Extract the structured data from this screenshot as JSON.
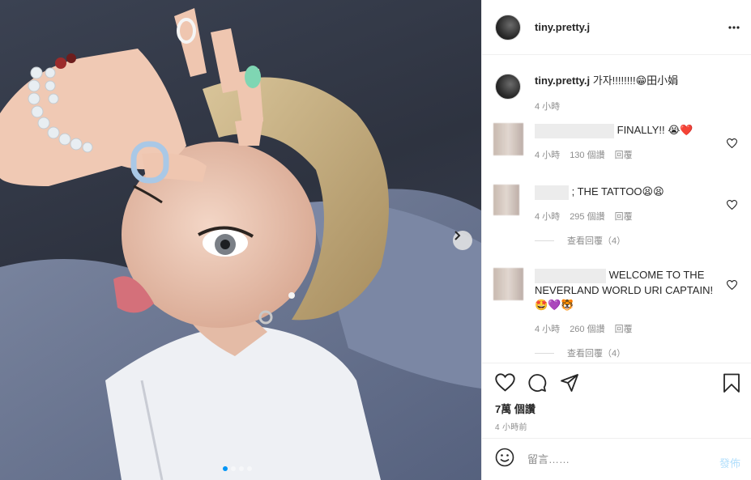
{
  "post": {
    "username": "tiny.pretty.j",
    "caption_user": "tiny.pretty.j",
    "caption_text": "가자!!!!!!!!😁田小娟",
    "caption_time": "4 小時",
    "likes": "7萬 個讚",
    "posted_ago": "4 小時前",
    "carousel": {
      "slide_count": 4,
      "current_slide": 1
    }
  },
  "comments": [
    {
      "text": "FINALLY!! 😭❤️",
      "time": "4 小時",
      "likes": "130 個讚",
      "reply": "回覆"
    },
    {
      "text": "; THE TATTOO😫😫",
      "time": "4 小時",
      "likes": "295 個讚",
      "reply": "回覆",
      "view_replies": "查看回覆（4）"
    },
    {
      "text": "WELCOME TO THE NEVERLAND WORLD URI CAPTAIN! 🤩💜🐯",
      "time": "4 小時",
      "likes": "260 個讚",
      "reply": "回覆",
      "view_replies": "查看回覆（4）"
    }
  ],
  "add_comment": {
    "placeholder": "留言……",
    "post_label": "發佈"
  },
  "colors": {
    "accent": "#0095f6",
    "post_disabled": "#b2dffc",
    "secondary_text": "#8e8e8e",
    "border": "#efefef"
  },
  "icons": [
    "more-icon",
    "heart-icon",
    "comment-icon",
    "share-icon",
    "bookmark-icon",
    "emoji-icon",
    "chevron-right-icon"
  ]
}
